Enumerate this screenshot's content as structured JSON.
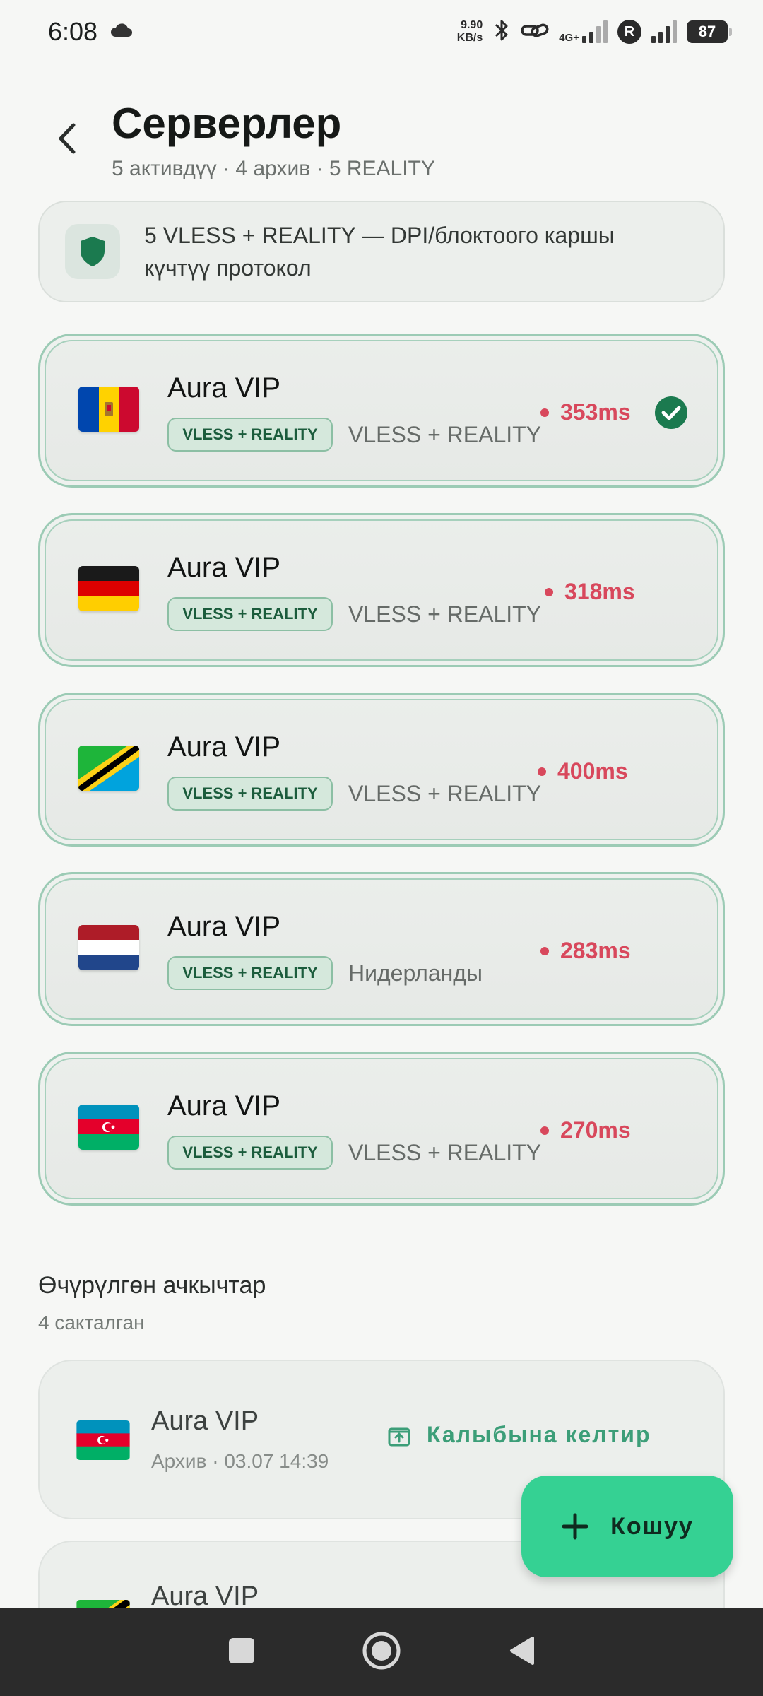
{
  "status_bar": {
    "time": "6:08",
    "net_speed_value": "9.90",
    "net_speed_unit": "KB/s",
    "network_type": "4G+",
    "r_badge": "R",
    "battery": "87"
  },
  "header": {
    "title": "Серверлер",
    "subtitle": "5 активдүү · 4 архив · 5 REALITY"
  },
  "info_banner": {
    "text": "5 VLESS + REALITY — DPI/блоктоого каршы күчтүү протокол",
    "icon": "shield-icon"
  },
  "servers": [
    {
      "flag": "moldova",
      "name": "Aura VIP",
      "tag": "VLESS + REALITY",
      "desc": "VLESS + REALITY",
      "ping": "353ms",
      "selected": true
    },
    {
      "flag": "germany",
      "name": "Aura VIP",
      "tag": "VLESS + REALITY",
      "desc": "VLESS + REALITY",
      "ping": "318ms",
      "selected": false
    },
    {
      "flag": "tanzania",
      "name": "Aura VIP",
      "tag": "VLESS + REALITY",
      "desc": "VLESS + REALITY",
      "ping": "400ms",
      "selected": false
    },
    {
      "flag": "netherlands",
      "name": "Aura VIP",
      "tag": "VLESS + REALITY",
      "desc": "Нидерланды",
      "ping": "283ms",
      "selected": false
    },
    {
      "flag": "azerbaijan",
      "name": "Aura VIP",
      "tag": "VLESS + REALITY",
      "desc": "VLESS + REALITY",
      "ping": "270ms",
      "selected": false
    }
  ],
  "archive": {
    "title": "Өчүрүлгөн ачкычтар",
    "subtitle": "4 сакталган",
    "items": [
      {
        "flag": "azerbaijan",
        "name": "Aura VIP",
        "meta": "Архив · 03.07 14:39",
        "restore_label": "Калыбына келтир"
      },
      {
        "flag": "tanzania",
        "name": "Aura VIP"
      }
    ]
  },
  "fab": {
    "label": "Кошуу"
  },
  "colors": {
    "accent": "#35d193",
    "ping": "#d8485c",
    "brand_green": "#1b7a4f"
  }
}
